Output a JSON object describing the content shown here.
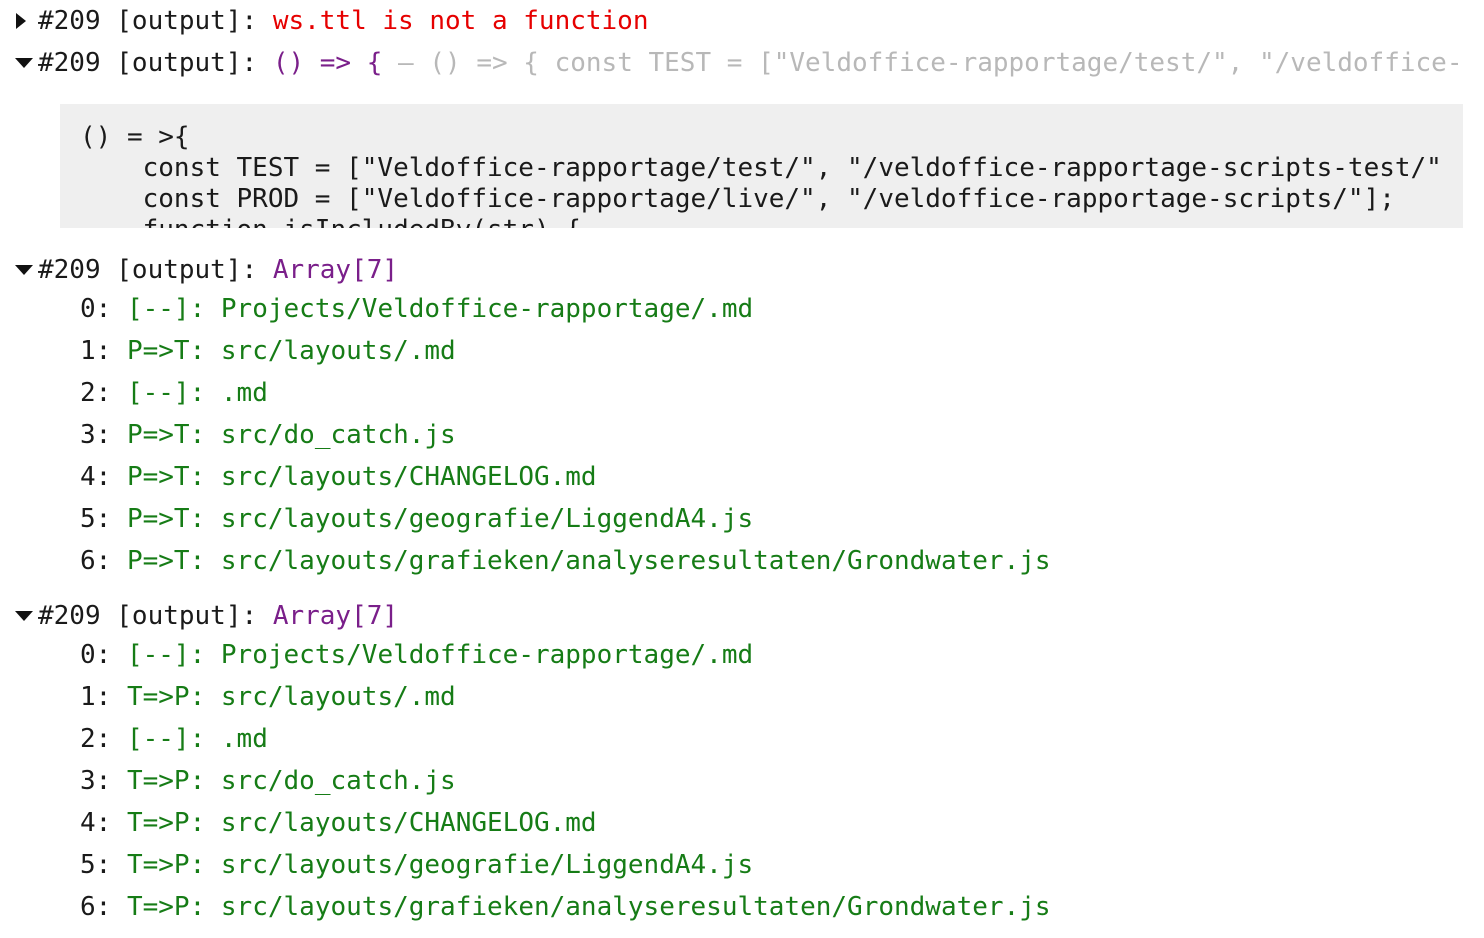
{
  "rows": [
    {
      "prefix": "#209 [output]:",
      "value": "ws.ttl is not a function",
      "collapsed": true
    },
    {
      "prefix": "#209 [output]:",
      "value": "() => {",
      "preview": "– () => { const TEST = [\"Veldoffice-rapportage/test/\", \"/veldoffice-",
      "collapsed": false
    }
  ],
  "code_box": {
    "lines": [
      "() = >{",
      "    const TEST = [\"Veldoffice-rapportage/test/\", \"/veldoffice-rapportage-scripts-test/\"",
      "    const PROD = [\"Veldoffice-rapportage/live/\", \"/veldoffice-rapportage-scripts/\"];",
      "    function isIncludedBy(str) {"
    ]
  },
  "arrays": [
    {
      "prefix": "#209 [output]:",
      "label": "Array[7]",
      "items": [
        {
          "index": "0:",
          "tag": "[--]:",
          "path": "Projects/Veldoffice-rapportage/.md"
        },
        {
          "index": "1:",
          "tag": "P=>T:",
          "path": "src/layouts/.md"
        },
        {
          "index": "2:",
          "tag": "[--]:",
          "path": ".md"
        },
        {
          "index": "3:",
          "tag": "P=>T:",
          "path": "src/do_catch.js"
        },
        {
          "index": "4:",
          "tag": "P=>T:",
          "path": "src/layouts/CHANGELOG.md"
        },
        {
          "index": "5:",
          "tag": "P=>T:",
          "path": "src/layouts/geografie/LiggendA4.js"
        },
        {
          "index": "6:",
          "tag": "P=>T:",
          "path": "src/layouts/grafieken/analyseresultaten/Grondwater.js"
        }
      ]
    },
    {
      "prefix": "#209 [output]:",
      "label": "Array[7]",
      "items": [
        {
          "index": "0:",
          "tag": "[--]:",
          "path": "Projects/Veldoffice-rapportage/.md"
        },
        {
          "index": "1:",
          "tag": "T=>P:",
          "path": "src/layouts/.md"
        },
        {
          "index": "2:",
          "tag": "[--]:",
          "path": ".md"
        },
        {
          "index": "3:",
          "tag": "T=>P:",
          "path": "src/do_catch.js"
        },
        {
          "index": "4:",
          "tag": "T=>P:",
          "path": "src/layouts/CHANGELOG.md"
        },
        {
          "index": "5:",
          "tag": "T=>P:",
          "path": "src/layouts/geografie/LiggendA4.js"
        },
        {
          "index": "6:",
          "tag": "T=>P:",
          "path": "src/layouts/grafieken/analyseresultaten/Grondwater.js"
        }
      ]
    }
  ],
  "colors": {
    "error": "#e60000",
    "purple": "#7a1f8a",
    "green": "#167c16",
    "muted": "#b8b8b8",
    "code_bg": "#efefef"
  },
  "icons": {
    "collapsed": "triangle-right-icon",
    "expanded": "triangle-down-icon"
  }
}
